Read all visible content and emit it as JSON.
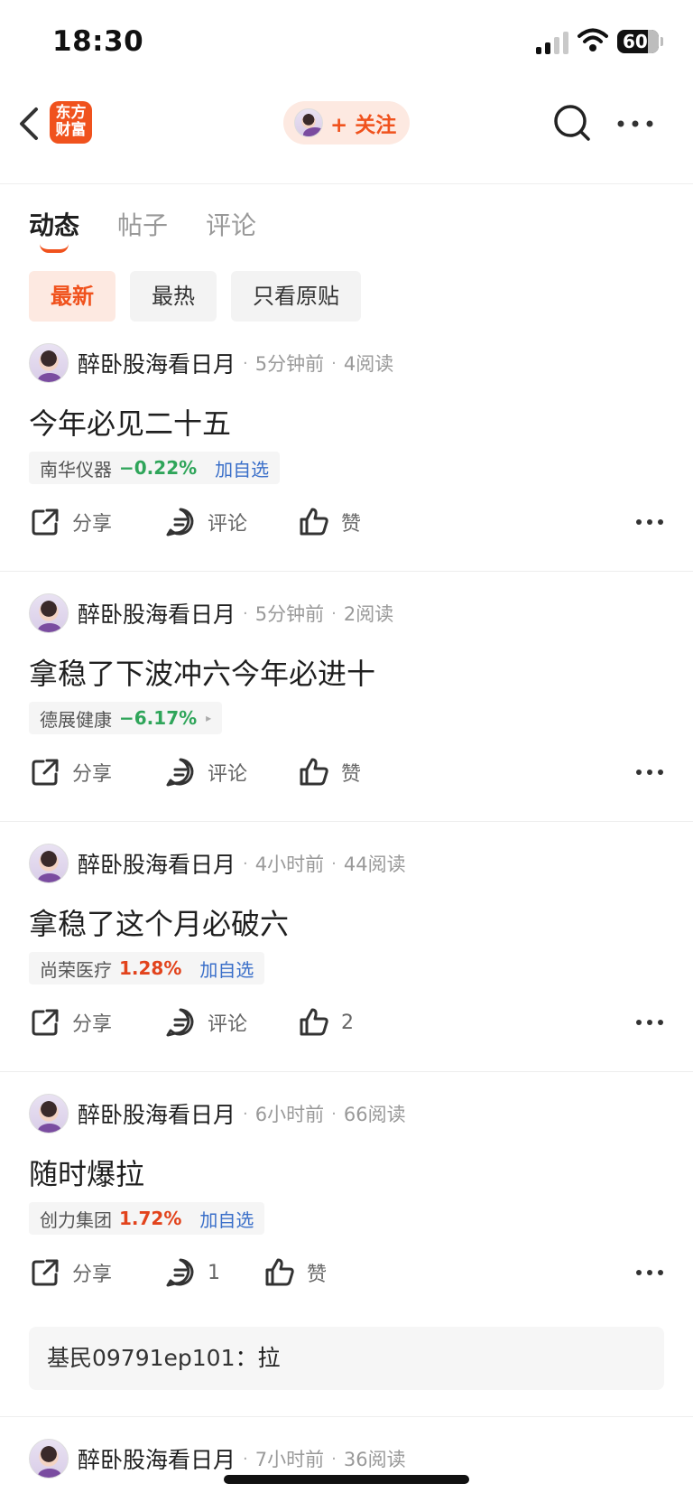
{
  "status_bar": {
    "time": "18:30",
    "battery": "60"
  },
  "header": {
    "logo_text": "东方\n财富",
    "follow_label": "+ 关注"
  },
  "tabs": [
    {
      "label": "动态"
    },
    {
      "label": "帖子"
    },
    {
      "label": "评论"
    }
  ],
  "filters": [
    {
      "label": "最新"
    },
    {
      "label": "最热"
    },
    {
      "label": "只看原贴"
    }
  ],
  "posts": [
    {
      "author": "醉卧股海看日月",
      "time": "5分钟前",
      "reads": "4阅读",
      "title": "今年必见二十五",
      "stock": {
        "name": "南华仪器",
        "change": "−0.22%",
        "direction": "down",
        "extra": "加自选"
      },
      "actions": {
        "share": "分享",
        "comment": "评论",
        "like": "赞"
      }
    },
    {
      "author": "醉卧股海看日月",
      "time": "5分钟前",
      "reads": "2阅读",
      "title": "拿稳了下波冲六今年必进十",
      "stock": {
        "name": "德展健康",
        "change": "−6.17%",
        "direction": "down",
        "extra": "▸"
      },
      "actions": {
        "share": "分享",
        "comment": "评论",
        "like": "赞"
      }
    },
    {
      "author": "醉卧股海看日月",
      "time": "4小时前",
      "reads": "44阅读",
      "title": "拿稳了这个月必破六",
      "stock": {
        "name": "尚荣医疗",
        "change": "1.28%",
        "direction": "up",
        "extra": "加自选"
      },
      "actions": {
        "share": "分享",
        "comment": "评论",
        "like": "2"
      }
    },
    {
      "author": "醉卧股海看日月",
      "time": "6小时前",
      "reads": "66阅读",
      "title": "随时爆拉",
      "stock": {
        "name": "创力集团",
        "change": "1.72%",
        "direction": "up",
        "extra": "加自选"
      },
      "actions": {
        "share": "分享",
        "comment": "1",
        "like": "赞"
      },
      "comment_preview": {
        "user": "基民09791ep101",
        "separator": "：",
        "text": "拉"
      }
    },
    {
      "author": "醉卧股海看日月",
      "time": "7小时前",
      "reads": "36阅读"
    }
  ],
  "colors": {
    "accent": "#f0521d",
    "down": "#2fa55a",
    "up": "#e2431c",
    "link": "#3a6fc9"
  }
}
